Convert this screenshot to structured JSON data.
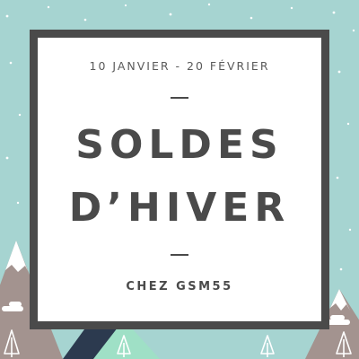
{
  "poster": {
    "dates": "10 JANVIER - 20 FÉVRIER",
    "title_line1": "SOLDES",
    "title_line2": "D’HIVER",
    "shop": "CHEZ GSM55"
  },
  "colors": {
    "sky": "#a6d4d1",
    "card_border": "#4a4a4a",
    "card_bg": "#ffffff",
    "text": "#4a4a4a",
    "mountain_taupe": "#a3938f",
    "mountain_navy": "#2c3a4f",
    "mountain_mint": "#9fe0c6",
    "snow": "#ffffff"
  },
  "icons": [
    "snowflake-dot",
    "mountain",
    "pine-tree",
    "cloud"
  ]
}
